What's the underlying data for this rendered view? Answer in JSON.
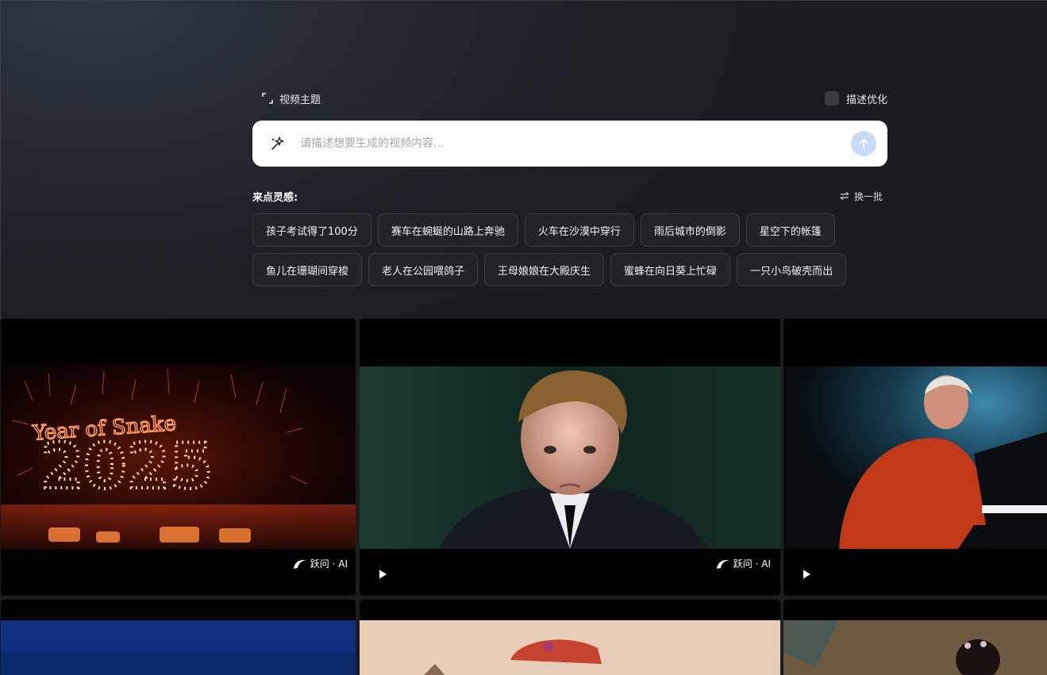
{
  "header": {
    "topic_label": "视频主题",
    "optimize_label": "描述优化"
  },
  "search": {
    "placeholder": "请描述想要生成的视频内容..."
  },
  "inspiration": {
    "title": "来点灵感:",
    "refresh_label": "换一批",
    "row1": [
      "孩子考试得了100分",
      "赛车在蜿蜒的山路上奔驰",
      "火车在沙漠中穿行",
      "雨后城市的倒影",
      "星空下的帐篷"
    ],
    "row2": [
      "鱼儿在珊瑚间穿梭",
      "老人在公园喂鸽子",
      "王母娘娘在大殿庆生",
      "蜜蜂在向日葵上忙碌",
      "一只小鸟破壳而出"
    ]
  },
  "gallery": {
    "watermark": "跃问 · AI",
    "fireworks_text": "Year of Snake",
    "fireworks_number": "2025"
  },
  "colors": {
    "accent": "#c8daf7",
    "chip_bg": "#22242a",
    "chip_border": "#3a3d44"
  }
}
